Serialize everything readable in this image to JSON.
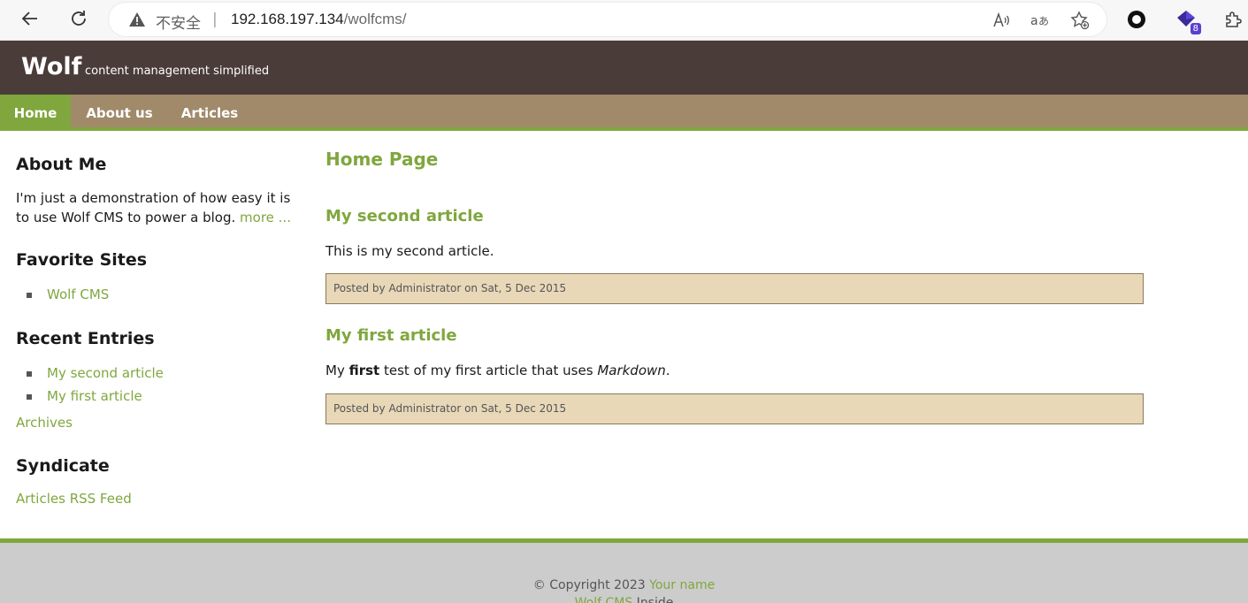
{
  "browser": {
    "security_label": "不安全",
    "separator": "|",
    "url_host": "192.168.197.134",
    "url_path": "/wolfcms/",
    "extension_badge": "8"
  },
  "site": {
    "title": "Wolf",
    "slogan": "content management simplified"
  },
  "menu": {
    "items": [
      {
        "label": "Home"
      },
      {
        "label": "About us"
      },
      {
        "label": "Articles"
      }
    ]
  },
  "sidebar": {
    "about": {
      "heading": "About Me",
      "text_line1": "I'm just a demonstration of how easy it is",
      "text_line2": "to use Wolf CMS to power a blog. ",
      "more_link": "more ..."
    },
    "favorites": {
      "heading": "Favorite Sites",
      "items": [
        "Wolf CMS"
      ]
    },
    "recent": {
      "heading": "Recent Entries",
      "items": [
        "My second article",
        "My first article"
      ],
      "archives_link": "Archives"
    },
    "syndicate": {
      "heading": "Syndicate",
      "rss_link": "Articles RSS Feed"
    }
  },
  "content": {
    "page_title": "Home Page",
    "articles": [
      {
        "title": "My second article",
        "body": "This is my second article.",
        "info": "Posted by Administrator on Sat, 5 Dec 2015"
      },
      {
        "title": "My first article",
        "body_prefix": "My ",
        "body_bold": "first",
        "body_middle": " test of my first article that uses ",
        "body_italic": "Markdown",
        "body_suffix": ".",
        "info": "Posted by Administrator on Sat, 5 Dec 2015"
      }
    ]
  },
  "footer": {
    "copyright": "© Copyright 2023 ",
    "your_name": "Your name",
    "wolf_cms": "Wolf CMS",
    "inside": " Inside"
  }
}
